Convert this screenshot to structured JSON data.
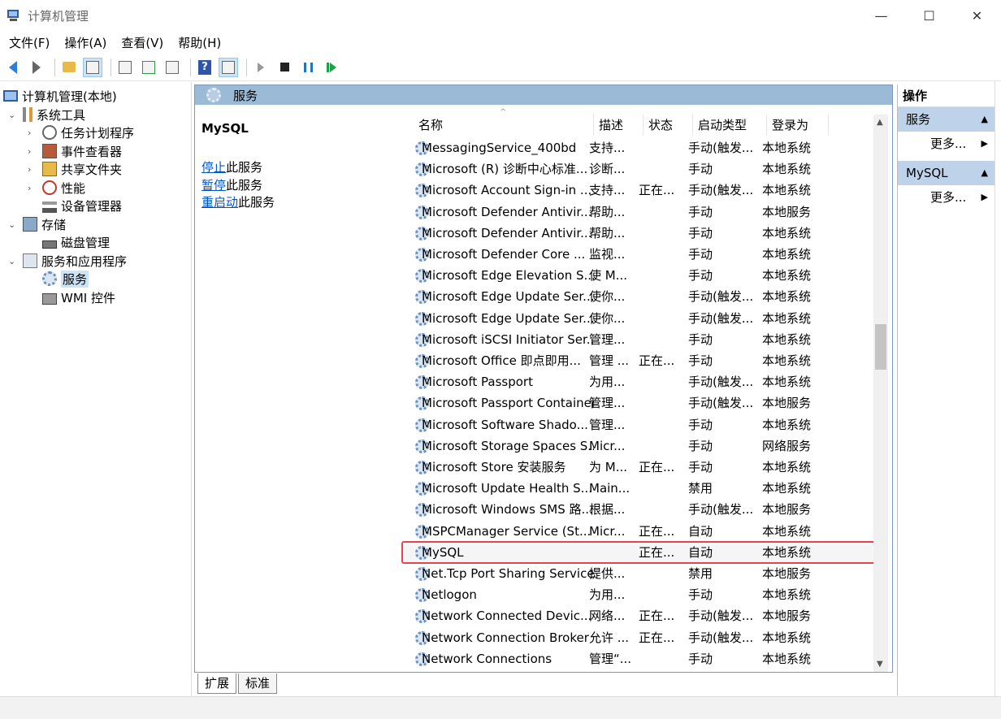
{
  "window": {
    "title": "计算机管理",
    "minimize": "—",
    "maximize": "☐",
    "close": "✕"
  },
  "menu": [
    "文件(F)",
    "操作(A)",
    "查看(V)",
    "帮助(H)"
  ],
  "tree": {
    "root": "计算机管理(本地)",
    "system_tools": "系统工具",
    "task_scheduler": "任务计划程序",
    "event_viewer": "事件查看器",
    "shared_folders": "共享文件夹",
    "performance": "性能",
    "device_manager": "设备管理器",
    "storage": "存储",
    "disk_management": "磁盘管理",
    "services_apps": "服务和应用程序",
    "services": "服务",
    "wmi": "WMI 控件"
  },
  "center": {
    "header": "服务",
    "selected_name": "MySQL",
    "links": [
      {
        "link": "停止",
        "rest": "此服务"
      },
      {
        "link": "暂停",
        "rest": "此服务"
      },
      {
        "link": "重启动",
        "rest": "此服务"
      }
    ],
    "columns": [
      "名称",
      "描述",
      "状态",
      "启动类型",
      "登录为"
    ],
    "rows": [
      [
        "MessagingService_400bd",
        "支持...",
        "",
        "手动(触发...",
        "本地系统"
      ],
      [
        "Microsoft (R) 诊断中心标准...",
        "诊断...",
        "",
        "手动",
        "本地系统"
      ],
      [
        "Microsoft Account Sign-in ...",
        "支持...",
        "正在...",
        "手动(触发...",
        "本地系统"
      ],
      [
        "Microsoft Defender Antivir...",
        "帮助...",
        "",
        "手动",
        "本地服务"
      ],
      [
        "Microsoft Defender Antivir...",
        "帮助...",
        "",
        "手动",
        "本地系统"
      ],
      [
        "Microsoft Defender Core ...",
        "监视...",
        "",
        "手动",
        "本地系统"
      ],
      [
        "Microsoft Edge Elevation S...",
        "使 M...",
        "",
        "手动",
        "本地系统"
      ],
      [
        "Microsoft Edge Update Ser...",
        "使你...",
        "",
        "手动(触发...",
        "本地系统"
      ],
      [
        "Microsoft Edge Update Ser...",
        "使你...",
        "",
        "手动(触发...",
        "本地系统"
      ],
      [
        "Microsoft iSCSI Initiator Ser...",
        "管理...",
        "",
        "手动",
        "本地系统"
      ],
      [
        "Microsoft Office 即点即用...",
        "管理 ...",
        "正在...",
        "手动",
        "本地系统"
      ],
      [
        "Microsoft Passport",
        "为用...",
        "",
        "手动(触发...",
        "本地系统"
      ],
      [
        "Microsoft Passport Container",
        "管理...",
        "",
        "手动(触发...",
        "本地服务"
      ],
      [
        "Microsoft Software Shado...",
        "管理...",
        "",
        "手动",
        "本地系统"
      ],
      [
        "Microsoft Storage Spaces S...",
        "Micr...",
        "",
        "手动",
        "网络服务"
      ],
      [
        "Microsoft Store 安装服务",
        "为 M...",
        "正在...",
        "手动",
        "本地系统"
      ],
      [
        "Microsoft Update Health S...",
        "Main...",
        "",
        "禁用",
        "本地系统"
      ],
      [
        "Microsoft Windows SMS 路...",
        "根据...",
        "",
        "手动(触发...",
        "本地服务"
      ],
      [
        "MSPCManager Service (St...",
        "Micr...",
        "正在...",
        "自动",
        "本地系统"
      ],
      [
        "MySQL",
        "",
        "正在...",
        "自动",
        "本地系统"
      ],
      [
        "Net.Tcp Port Sharing Service",
        "提供...",
        "",
        "禁用",
        "本地服务"
      ],
      [
        "Netlogon",
        "为用...",
        "",
        "手动",
        "本地系统"
      ],
      [
        "Network Connected Devic...",
        "网络...",
        "正在...",
        "手动(触发...",
        "本地服务"
      ],
      [
        "Network Connection Broker",
        "允许 ...",
        "正在...",
        "手动(触发...",
        "本地系统"
      ],
      [
        "Network Connections",
        "管理“...",
        "",
        "手动",
        "本地系统"
      ]
    ],
    "highlighted_row": "MySQL",
    "tabs": [
      "扩展",
      "标准"
    ]
  },
  "actions": {
    "title": "操作",
    "group1": "服务",
    "more1": "更多...",
    "group2": "MySQL",
    "more2": "更多..."
  },
  "colors": {
    "accent": "#9bbad6",
    "highlight_border": "#e0464e",
    "link": "#0055cc"
  }
}
